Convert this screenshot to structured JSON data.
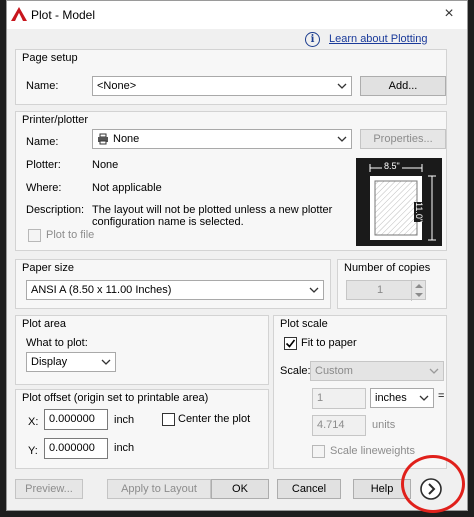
{
  "window": {
    "title": "Plot - Model",
    "close_label": "×"
  },
  "help_link": {
    "label": "Learn about Plotting",
    "icon": "info-icon"
  },
  "page_setup": {
    "title": "Page setup",
    "name_label": "Name:",
    "name_value": "<None>",
    "add_button": "Add..."
  },
  "printer": {
    "title": "Printer/plotter",
    "name_label": "Name:",
    "name_value": "None",
    "properties_button": "Properties...",
    "plotter_label": "Plotter:",
    "plotter_value": "None",
    "where_label": "Where:",
    "where_value": "Not applicable",
    "description_label": "Description:",
    "description_line1": "The layout will not be plotted unless a new plotter",
    "description_line2": "configuration name is selected.",
    "plot_to_file_label": "Plot to file",
    "preview_width": "8.5\"",
    "preview_height": "11.0\""
  },
  "paper_size": {
    "title": "Paper size",
    "value": "ANSI A (8.50 x 11.00 Inches)"
  },
  "copies": {
    "title": "Number of copies",
    "value": "1"
  },
  "plot_area": {
    "title": "Plot area",
    "what_label": "What to plot:",
    "what_value": "Display"
  },
  "plot_offset": {
    "title": "Plot offset (origin set to printable area)",
    "x_label": "X:",
    "x_value": "0.000000",
    "x_unit": "inch",
    "y_label": "Y:",
    "y_value": "0.000000",
    "y_unit": "inch",
    "center_label": "Center the plot"
  },
  "plot_scale": {
    "title": "Plot scale",
    "fit_label": "Fit to paper",
    "fit_checked": true,
    "scale_label": "Scale:",
    "scale_value": "Custom",
    "inches_value": "1",
    "inches_unit": "inches",
    "equals": "=",
    "units_value": "4.714",
    "units_label": "units",
    "lineweights_label": "Scale lineweights"
  },
  "buttons": {
    "preview": "Preview...",
    "apply": "Apply to Layout",
    "ok": "OK",
    "cancel": "Cancel",
    "help": "Help",
    "more_icon": "chevron-right-icon"
  },
  "colors": {
    "annotation_circle": "#e0201b",
    "link": "#1a3a9a"
  }
}
